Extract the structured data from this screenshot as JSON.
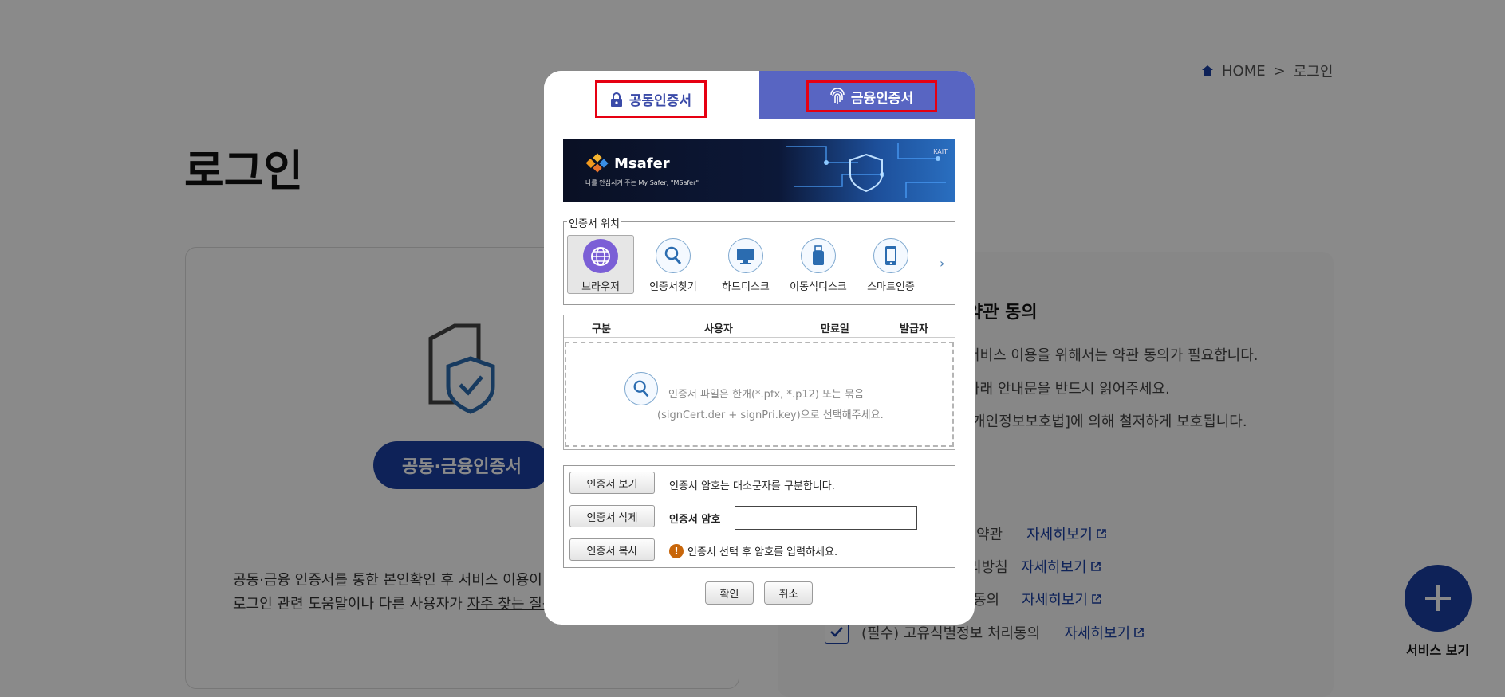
{
  "breadcrumb": {
    "home": "HOME",
    "separator": ">",
    "current": "로그인"
  },
  "page": {
    "title": "로그인"
  },
  "left_card": {
    "cert_button": "공동·금융인증서",
    "help_line1": "공동·금융 인증서를 통한 본인확인 후 서비스 이용이 가",
    "help_line2_prefix": "로그인 관련 도움말이나 다른 사용자가 ",
    "help_line2_link": "자주 찾는 질문"
  },
  "right_card": {
    "title": "약관 동의",
    "lines": [
      "서비스 이용을 위해서는 약관 동의가 필요합니다.",
      "아래 안내문을 반드시 읽어주세요.",
      "[개인정보보호법]에 의해 철저하게 보호됩니다."
    ],
    "terms": [
      {
        "label": "약관",
        "link": "자세히보기"
      },
      {
        "label": "리방침",
        "link": "자세히보기"
      },
      {
        "label": "동의",
        "link": "자세히보기"
      },
      {
        "label": "(필수) 고유식별정보 처리동의",
        "link": "자세히보기"
      }
    ]
  },
  "service": {
    "label": "서비스 보기"
  },
  "modal": {
    "tabs": [
      {
        "label": "공동인증서",
        "icon": "lock-icon"
      },
      {
        "label": "금융인증서",
        "icon": "fingerprint-icon"
      }
    ],
    "banner": {
      "brand": "Msafer",
      "slogan": "나를 안심시켜 주는 My Safer, \"MSafer\"",
      "badge": "KAIT"
    },
    "location": {
      "legend": "인증서 위치",
      "items": [
        {
          "label": "브라우저",
          "icon": "globe-icon"
        },
        {
          "label": "인증서찾기",
          "icon": "magnifier-icon"
        },
        {
          "label": "하드디스크",
          "icon": "monitor-icon"
        },
        {
          "label": "이동식디스크",
          "icon": "usb-icon"
        },
        {
          "label": "스마트인증",
          "icon": "smartphone-icon"
        }
      ]
    },
    "table": {
      "headers": [
        "구분",
        "사용자",
        "만료일",
        "발급자"
      ],
      "drop_text1": "인증서 파일은 한개(*.pfx, *.p12) 또는 묶음",
      "drop_text2": "(signCert.der + signPri.key)으로 선택해주세요."
    },
    "actions": {
      "view": "인증서 보기",
      "delete": "인증서 삭제",
      "copy": "인증서 복사",
      "case_note": "인증서 암호는 대소문자를 구분합니다.",
      "password_label": "인증서 암호",
      "password_value": "",
      "hint": "인증서 선택 후 암호를 입력하세요."
    },
    "buttons": {
      "ok": "확인",
      "cancel": "취소"
    }
  },
  "colors": {
    "accent": "#1a3fa3",
    "tab_active_bg": "#5865c2",
    "highlight_box": "#e60012"
  }
}
